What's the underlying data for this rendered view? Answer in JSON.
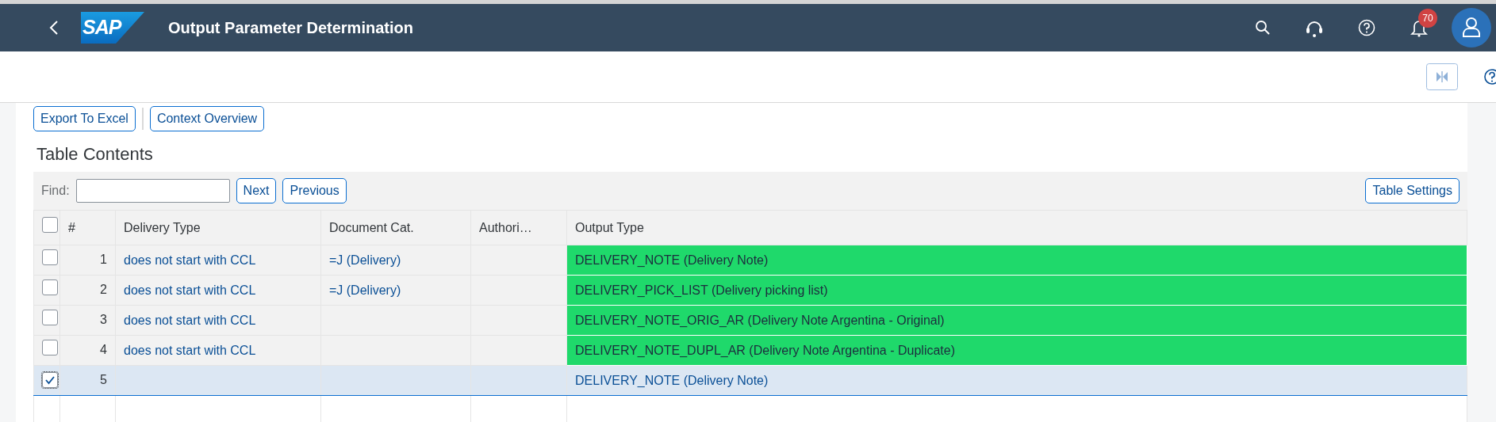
{
  "shell": {
    "logo": "SAP",
    "title": "Output Parameter Determination",
    "notification_count": "70"
  },
  "toolbar": {
    "buttons": [
      "Export To Excel",
      "Context Overview"
    ]
  },
  "table": {
    "title": "Table Contents",
    "find_label": "Find:",
    "find_buttons": [
      "Next",
      "Previous"
    ],
    "settings_button": "Table Settings",
    "select_all": {
      "checked": false
    },
    "columns": [
      "#",
      "Delivery Type",
      "Document Cat.",
      "Authori…",
      "Output Type"
    ],
    "rows": [
      {
        "number": "1",
        "delivery_type": "does not start with CCL",
        "document_cat": "=J (Delivery)",
        "output_type": "DELIVERY_NOTE (Delivery Note)",
        "color": "#1fd96b",
        "checked": false,
        "selected": false
      },
      {
        "number": "2",
        "delivery_type": "does not start with CCL",
        "document_cat": "=J (Delivery)",
        "output_type": "DELIVERY_PICK_LIST (Delivery picking list)",
        "color": "#1fd96b",
        "checked": false,
        "selected": false
      },
      {
        "number": "3",
        "delivery_type": "does not start with CCL",
        "output_type": "DELIVERY_NOTE_ORIG_AR (Delivery Note Argentina - Original)",
        "color": "#1fd96b",
        "checked": false,
        "selected": false
      },
      {
        "number": "4",
        "delivery_type": "does not start with CCL",
        "output_type": "DELIVERY_NOTE_DUPL_AR (Delivery Note Argentina - Duplicate)",
        "color": "#1fd96b",
        "checked": false,
        "selected": false
      },
      {
        "number": "5",
        "output_type": "DELIVERY_NOTE (Delivery Note)",
        "checked": true,
        "selected": true
      }
    ]
  }
}
